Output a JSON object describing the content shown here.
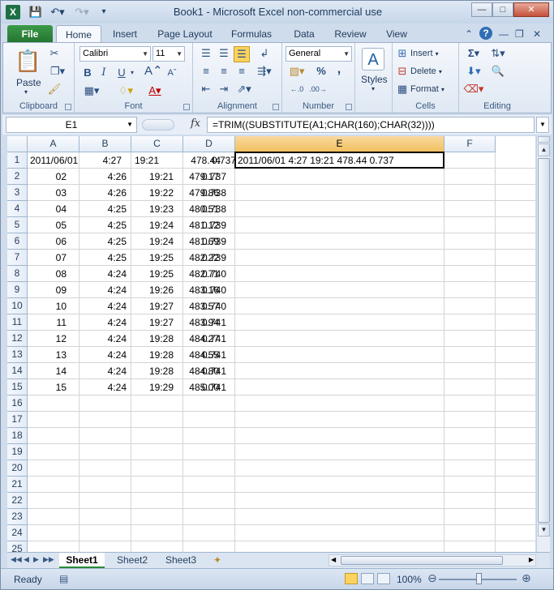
{
  "window": {
    "title": "Book1  -  Microsoft Excel non-commercial use",
    "app_icon": "X"
  },
  "tabs": [
    "File",
    "Home",
    "Insert",
    "Page Layout",
    "Formulas",
    "Data",
    "Review",
    "View"
  ],
  "ribbon": {
    "clipboard": {
      "label": "Clipboard",
      "paste": "Paste"
    },
    "font": {
      "label": "Font",
      "name": "Calibri",
      "size": "11",
      "bold": "B",
      "italic": "I",
      "underline": "U"
    },
    "alignment": {
      "label": "Alignment"
    },
    "number": {
      "label": "Number",
      "format": "General",
      "percent": "%",
      "comma": ","
    },
    "styles": {
      "label": "Styles"
    },
    "cells": {
      "label": "Cells",
      "insert": "Insert",
      "delete": "Delete",
      "format": "Format"
    },
    "editing": {
      "label": "Editing"
    }
  },
  "formula_bar": {
    "name_box": "E1",
    "fx": "fx",
    "formula": "=TRIM((SUBSTITUTE(A1;CHAR(160);CHAR(32))))"
  },
  "sheet": {
    "columns": [
      "A",
      "B",
      "C",
      "D",
      "E",
      "F"
    ],
    "selected_column": "E",
    "row_numbers": [
      "1",
      "2",
      "3",
      "4",
      "5",
      "6",
      "7",
      "8",
      "9",
      "10",
      "11",
      "12",
      "13",
      "14",
      "15",
      "16",
      "17",
      "18",
      "19",
      "20",
      "21",
      "22",
      "23",
      "24",
      "25"
    ],
    "rows": [
      [
        "2011/06/01",
        "4:27",
        "19:21",
        "478.44",
        "0.737"
      ],
      [
        "02",
        "4:26",
        "19:21",
        "479.17",
        "0.737"
      ],
      [
        "03",
        "4:26",
        "19:22",
        "479.86",
        "0.738"
      ],
      [
        "04",
        "4:25",
        "19:23",
        "480.51",
        "0.738"
      ],
      [
        "05",
        "4:25",
        "19:24",
        "481.12",
        "0.739"
      ],
      [
        "06",
        "4:25",
        "19:24",
        "481.69",
        "0.739"
      ],
      [
        "07",
        "4:25",
        "19:25",
        "482.22",
        "0.739"
      ],
      [
        "08",
        "4:24",
        "19:25",
        "482.71",
        "0.740"
      ],
      [
        "09",
        "4:24",
        "19:26",
        "483.16",
        "0.740"
      ],
      [
        "10",
        "4:24",
        "19:27",
        "483.57",
        "0.740"
      ],
      [
        "11",
        "4:24",
        "19:27",
        "483.94",
        "0.741"
      ],
      [
        "12",
        "4:24",
        "19:28",
        "484.27",
        "0.741"
      ],
      [
        "13",
        "4:24",
        "19:28",
        "484.55",
        "0.741"
      ],
      [
        "14",
        "4:24",
        "19:28",
        "484.80",
        "0.741"
      ],
      [
        "15",
        "4:24",
        "19:29",
        "485.00",
        "0.741"
      ]
    ],
    "e1_value": "2011/06/01 4:27 19:21 478.44 0.737"
  },
  "sheet_tabs": [
    "Sheet1",
    "Sheet2",
    "Sheet3"
  ],
  "active_sheet": "Sheet1",
  "status": {
    "text": "Ready",
    "zoom": "100%"
  }
}
